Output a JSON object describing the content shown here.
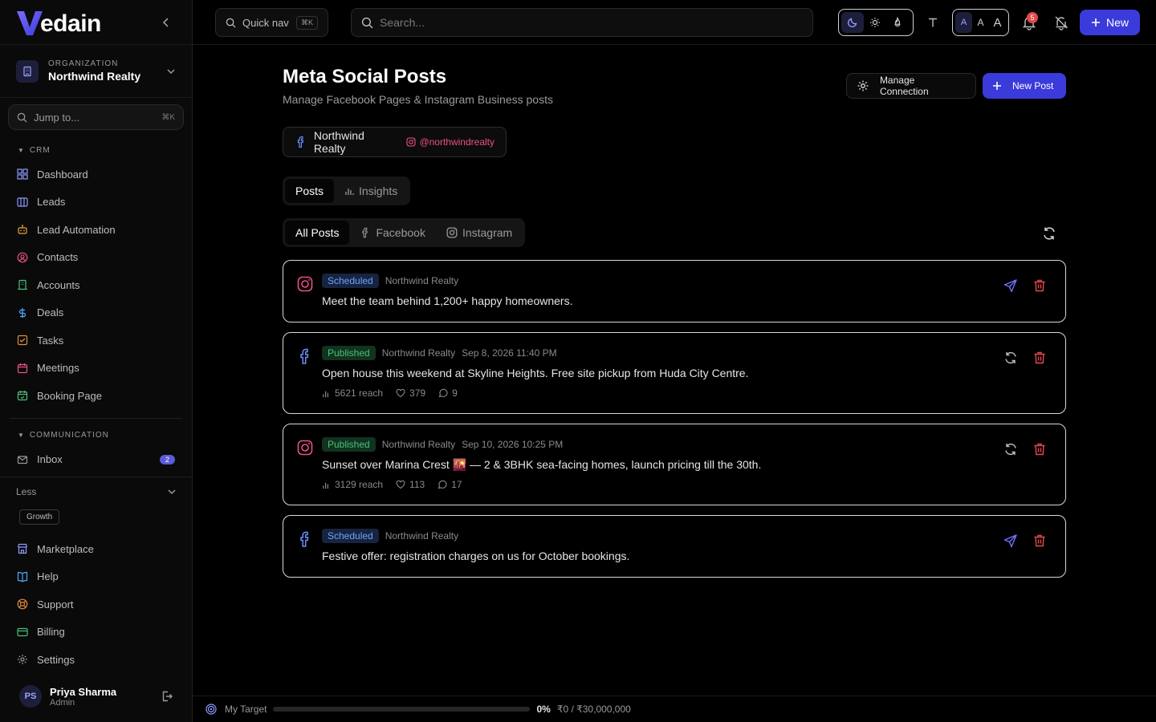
{
  "brand": {
    "logo_text": "edain"
  },
  "org": {
    "label": "ORGANIZATION",
    "name": "Northwind Realty"
  },
  "sidebar": {
    "jump": {
      "placeholder": "Jump to...",
      "shortcut": "⌘K"
    },
    "crm": {
      "title": "CRM",
      "items": [
        {
          "label": "Dashboard",
          "icon": "grid-icon"
        },
        {
          "label": "Leads",
          "icon": "kanban-icon"
        },
        {
          "label": "Lead Automation",
          "icon": "robot-icon"
        },
        {
          "label": "Contacts",
          "icon": "user-circle-icon"
        },
        {
          "label": "Accounts",
          "icon": "building-icon"
        },
        {
          "label": "Deals",
          "icon": "dollar-icon"
        },
        {
          "label": "Tasks",
          "icon": "checkbox-icon"
        },
        {
          "label": "Meetings",
          "icon": "calendar-icon"
        },
        {
          "label": "Booking Page",
          "icon": "calendar-check-icon"
        }
      ]
    },
    "communication": {
      "title": "COMMUNICATION",
      "items": [
        {
          "label": "Inbox",
          "icon": "mail-icon",
          "badge": "2"
        }
      ]
    },
    "less_label": "Less",
    "growth_tag": "Growth",
    "bottom_items": [
      {
        "label": "Marketplace",
        "icon": "store-icon"
      },
      {
        "label": "Help",
        "icon": "book-icon"
      },
      {
        "label": "Support",
        "icon": "lifebuoy-icon"
      },
      {
        "label": "Billing",
        "icon": "credit-card-icon"
      },
      {
        "label": "Settings",
        "icon": "gear-icon"
      }
    ]
  },
  "user": {
    "initials": "PS",
    "name": "Priya Sharma",
    "role": "Admin"
  },
  "topbar": {
    "quicknav_label": "Quick nav",
    "quicknav_shortcut": "⌘K",
    "search_placeholder": "Search...",
    "size_labels": [
      "A",
      "A",
      "A"
    ],
    "notification_count": "5",
    "new_label": "New"
  },
  "page": {
    "title": "Meta Social Posts",
    "subtitle": "Manage Facebook Pages & Instagram Business posts",
    "manage_label": "Manage Connection",
    "new_post_label": "New Post",
    "account": {
      "name": "Northwind Realty",
      "handle": "@northwindrealty"
    },
    "tabs": [
      "Posts",
      "Insights"
    ],
    "filters": [
      "All Posts",
      "Facebook",
      "Instagram"
    ]
  },
  "posts": [
    {
      "platform": "instagram",
      "status": "Scheduled",
      "author": "Northwind Realty",
      "date": "",
      "text": "Meet the team behind 1,200+ happy homeowners.",
      "reach": "",
      "likes": "",
      "comments": ""
    },
    {
      "platform": "facebook",
      "status": "Published",
      "author": "Northwind Realty",
      "date": "Sep 8, 2026 11:40 PM",
      "text": "Open house this weekend at Skyline Heights. Free site pickup from Huda City Centre.",
      "reach": "5621 reach",
      "likes": "379",
      "comments": "9"
    },
    {
      "platform": "instagram",
      "status": "Published",
      "author": "Northwind Realty",
      "date": "Sep 10, 2026 10:25 PM",
      "text": "Sunset over Marina Crest 🌇 — 2 & 3BHK sea-facing homes, launch pricing till the 30th.",
      "reach": "3129 reach",
      "likes": "113",
      "comments": "17"
    },
    {
      "platform": "facebook",
      "status": "Scheduled",
      "author": "Northwind Realty",
      "date": "",
      "text": "Festive offer: registration charges on us for October bookings.",
      "reach": "",
      "likes": "",
      "comments": ""
    }
  ],
  "footer": {
    "target_label": "My Target",
    "progress_percent": 0,
    "percent_label": "0%",
    "amount": "₹0 / ₹30,000,000"
  },
  "colors": {
    "accent": "#3b3bdb",
    "scheduled": "#6ea2ff",
    "published": "#49c07a",
    "instagram": "#e8508a",
    "facebook": "#6e8fff",
    "delete": "#e5484d"
  }
}
